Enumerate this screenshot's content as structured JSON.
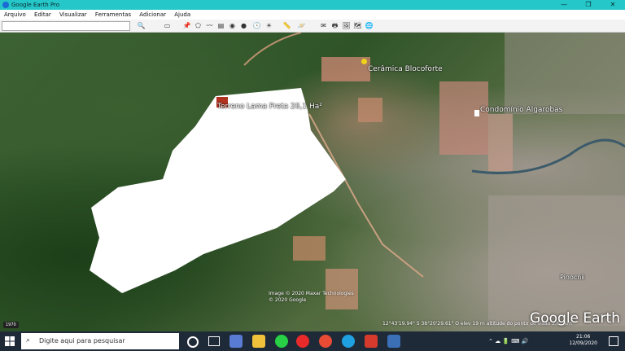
{
  "window": {
    "title": "Google Earth Pro",
    "controls": [
      "—",
      "❐",
      "✕"
    ]
  },
  "menu": [
    "Arquivo",
    "Editar",
    "Visualizar",
    "Ferramentas",
    "Adicionar",
    "Ajuda"
  ],
  "map": {
    "labels": {
      "terreno": "Terreno Lama Preta 26,1 Ha²",
      "ceramica": "Cerâmica Blocoforte",
      "condominio": "Condomínio Algarobas",
      "pinocnii": "Pinocnii"
    },
    "copyright": [
      "Image © 2020 Maxar Technologies",
      "© 2020 Google"
    ],
    "status": "12°43'19.94\" S   38°20'29.61\" O   elev  19 m   altitude do ponto de visão  2.62 km",
    "brand": "Google Earth",
    "year_badge": "1970"
  },
  "taskbar": {
    "search_placeholder": "Digite aqui para pesquisar",
    "time": "21:06",
    "date": "12/09/2020"
  }
}
